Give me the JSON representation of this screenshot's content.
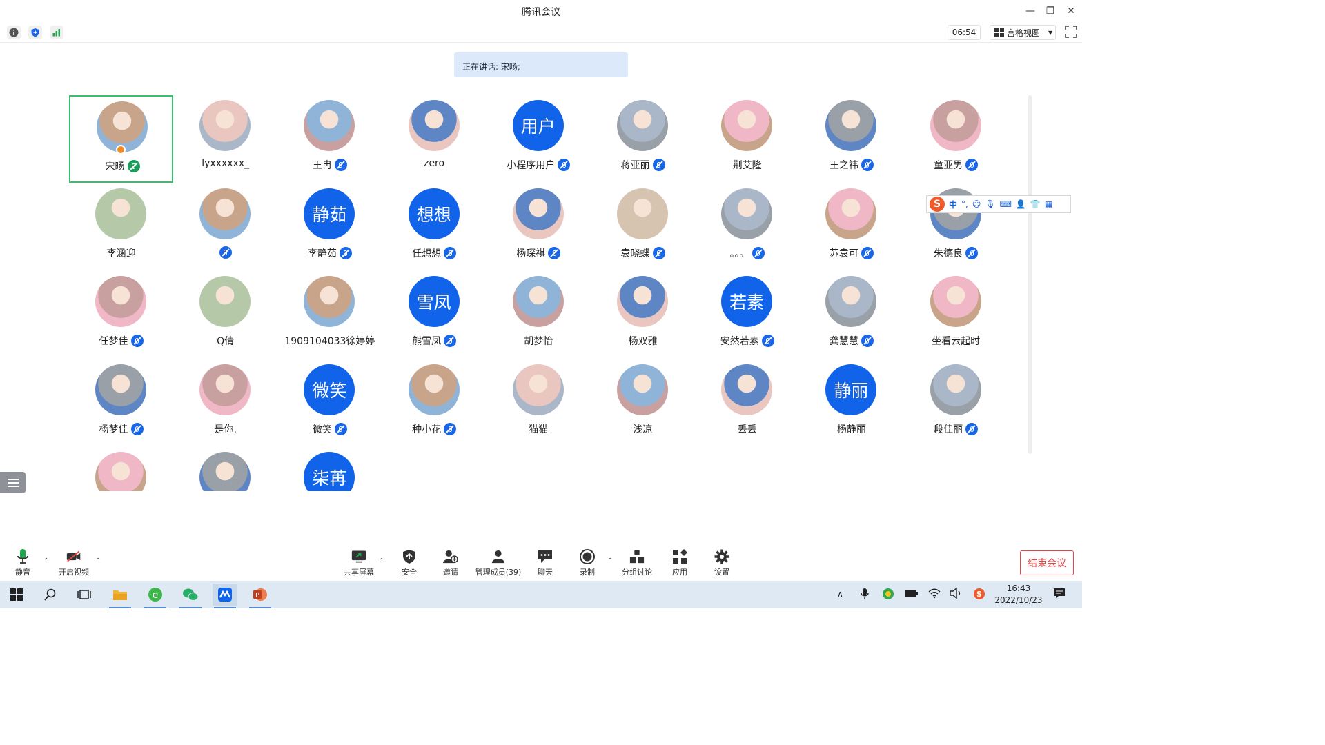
{
  "window": {
    "title": "腾讯会议"
  },
  "toolbar": {
    "clock": "06:54",
    "view_label": "宫格视图"
  },
  "speaking": "正在讲话: 宋旸;",
  "participants": [
    {
      "name": "宋旸",
      "avatar": "photo",
      "mic": "speaking",
      "host": true
    },
    {
      "name": "lyxxxxxx_",
      "avatar": "photo",
      "mic": "none"
    },
    {
      "name": "王冉",
      "avatar": "photo",
      "mic": "muted"
    },
    {
      "name": "zero",
      "avatar": "photo",
      "mic": "none"
    },
    {
      "name": "小程序用户",
      "avatar_text": "用户",
      "mic": "muted"
    },
    {
      "name": "蒋亚丽",
      "avatar": "photo",
      "mic": "muted"
    },
    {
      "name": "荆艾隆",
      "avatar": "photo",
      "mic": "none"
    },
    {
      "name": "王之祎",
      "avatar": "photo",
      "mic": "muted"
    },
    {
      "name": "童亚男",
      "avatar": "photo",
      "mic": "muted"
    },
    {
      "name": "李涵迎",
      "avatar": "photo",
      "mic": "none"
    },
    {
      "name": "",
      "avatar": "photo",
      "mic": "muted"
    },
    {
      "name": "李静茹",
      "avatar_text": "静茹",
      "mic": "muted"
    },
    {
      "name": "任想想",
      "avatar_text": "想想",
      "mic": "muted"
    },
    {
      "name": "杨琛祺",
      "avatar": "photo",
      "mic": "muted"
    },
    {
      "name": "袁晓蝶",
      "avatar": "photo",
      "mic": "muted"
    },
    {
      "name": "。。。",
      "avatar": "photo",
      "mic": "muted"
    },
    {
      "name": "苏袁可",
      "avatar": "photo",
      "mic": "muted"
    },
    {
      "name": "朱德良",
      "avatar": "photo",
      "mic": "muted"
    },
    {
      "name": "任梦佳",
      "avatar": "photo",
      "mic": "muted"
    },
    {
      "name": "Q倩",
      "avatar": "photo",
      "mic": "none"
    },
    {
      "name": "1909104033徐婷婷",
      "avatar": "photo",
      "mic": "none"
    },
    {
      "name": "熊雪凤",
      "avatar_text": "雪凤",
      "mic": "muted"
    },
    {
      "name": "胡梦怡",
      "avatar": "photo",
      "mic": "none"
    },
    {
      "name": "杨双雅",
      "avatar": "photo",
      "mic": "none"
    },
    {
      "name": "安然若素",
      "avatar_text": "若素",
      "mic": "muted"
    },
    {
      "name": "龚慧慧",
      "avatar": "photo",
      "mic": "muted"
    },
    {
      "name": "坐看云起时",
      "avatar": "photo",
      "mic": "none"
    },
    {
      "name": "杨梦佳",
      "avatar": "photo",
      "mic": "muted"
    },
    {
      "name": "是你.",
      "avatar": "photo",
      "mic": "none"
    },
    {
      "name": "微笑",
      "avatar_text": "微笑",
      "mic": "muted"
    },
    {
      "name": "种小花",
      "avatar": "photo",
      "mic": "muted"
    },
    {
      "name": "猫猫",
      "avatar": "photo",
      "mic": "none"
    },
    {
      "name": "浅凉",
      "avatar": "photo",
      "mic": "none"
    },
    {
      "name": "丢丢",
      "avatar": "photo",
      "mic": "none"
    },
    {
      "name": "杨静丽",
      "avatar_text": "静丽",
      "mic": "none"
    },
    {
      "name": "段佳丽",
      "avatar": "photo",
      "mic": "muted"
    },
    {
      "name": "",
      "avatar": "photo",
      "mic": "none"
    },
    {
      "name": "",
      "avatar": "photo",
      "mic": "none"
    },
    {
      "name": "",
      "avatar_text": "柒苒",
      "mic": "none"
    }
  ],
  "ime": {
    "lang": "中",
    "punct": "°,"
  },
  "bottom": {
    "mute": "静音",
    "video": "开启视频",
    "share": "共享屏幕",
    "security": "安全",
    "invite": "邀请",
    "members": "管理成员(39)",
    "chat": "聊天",
    "record": "录制",
    "breakout": "分组讨论",
    "apps": "应用",
    "settings": "设置",
    "end": "结束会议"
  },
  "taskbar": {
    "time": "16:43",
    "date": "2022/10/23"
  },
  "colors": {
    "accent": "#1164e9",
    "speaker": "#33c26b",
    "end": "#e54545",
    "speaking_bg": "#dbe9fb"
  }
}
